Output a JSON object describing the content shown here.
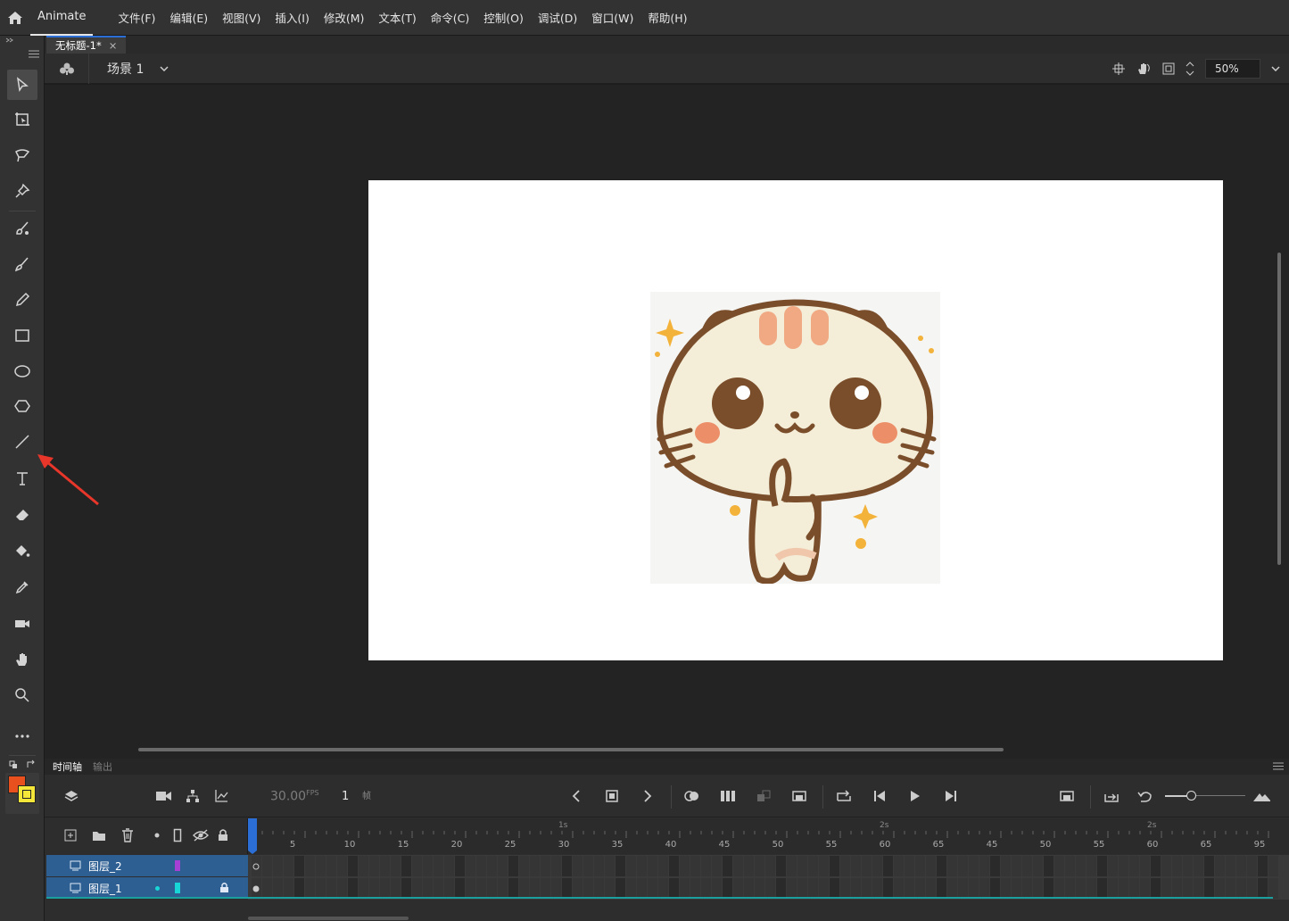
{
  "app": {
    "name": "Animate",
    "menus": [
      "文件(F)",
      "编辑(E)",
      "视图(V)",
      "插入(I)",
      "修改(M)",
      "文本(T)",
      "命令(C)",
      "控制(O)",
      "调试(D)",
      "窗口(W)",
      "帮助(H)"
    ]
  },
  "document": {
    "tab_title": "无标题-1*",
    "tab_close": "×"
  },
  "scene": {
    "name": "场景 1",
    "zoom": "50%"
  },
  "tools": [
    "selection-tool",
    "free-transform-tool",
    "lasso-tool",
    "pin-tool",
    "fluid-brush-tool",
    "paint-brush-tool",
    "pencil-tool",
    "rectangle-tool",
    "oval-tool",
    "polystar-tool",
    "line-tool",
    "text-tool",
    "eraser-tool",
    "paint-bucket-tool",
    "eyedropper-tool",
    "camera-tool",
    "hand-tool",
    "zoom-tool",
    "more-tools"
  ],
  "colors": {
    "stroke": "#e8501e",
    "fill": "#f5e63a",
    "accent": "#2b6fd6",
    "layer_selected": "#2e5f93",
    "layer2_color": "#a63fd4",
    "layer1_color": "#19d6d6",
    "arrow": "#e8362a"
  },
  "timeline": {
    "tabs": [
      "时间轴",
      "输出"
    ],
    "fps": "30.00",
    "fps_unit": "FPS",
    "current_frame": "1",
    "frame_label": "帧",
    "second_markers": [
      "1s",
      "2s",
      "2s"
    ],
    "ruler_ticks": [
      "5",
      "10",
      "15",
      "20",
      "25",
      "30",
      "35",
      "40",
      "45",
      "50",
      "55",
      "60",
      "65",
      "45",
      "50",
      "55",
      "60",
      "65",
      "95"
    ],
    "layers": [
      {
        "name": "图层_2"
      },
      {
        "name": "图层_1"
      }
    ]
  }
}
